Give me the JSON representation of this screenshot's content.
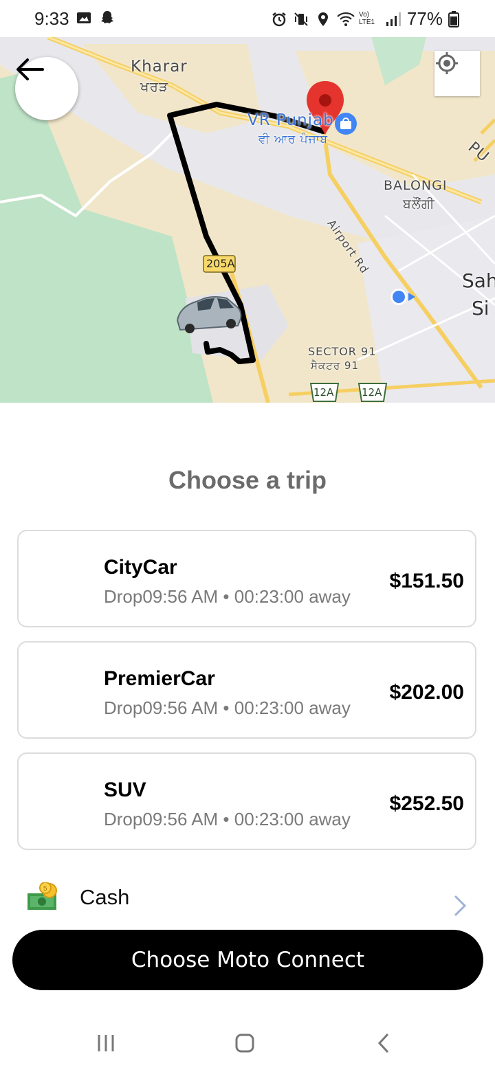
{
  "status_bar": {
    "time": "9:33",
    "battery": "77%",
    "left_icons": [
      "gallery-icon",
      "snapchat-icon"
    ],
    "right_icons": [
      "alarm-icon",
      "vibrate-icon",
      "location-icon",
      "wifi-icon",
      "volte-icon",
      "signal-icon",
      "battery-icon"
    ]
  },
  "map": {
    "labels": {
      "kharar": "Kharar",
      "kharar_local": "ਖਰੜ",
      "vr_punjab": "VR Punjab",
      "vr_punjab_local": "ਵੀ ਆਰ ਪੰਜਾਬ",
      "balongi": "BALONGI",
      "balongi_local": "ਬਲੌਂਗੀ",
      "airport_rd": "Airport Rd",
      "road_205a": "205A",
      "sector91": "SECTOR 91",
      "sector91_local": "ਸੈਕਟਰ 91",
      "road_12a_1": "12A",
      "road_12a_2": "12A",
      "sah": "Sah",
      "si": "Si",
      "pu": "PU"
    }
  },
  "panel": {
    "title": "Choose a trip"
  },
  "trips": [
    {
      "name": "CityCar",
      "subtitle": "Drop09:56 AM • 00:23:00 away",
      "price": "$151.50"
    },
    {
      "name": "PremierCar",
      "subtitle": "Drop09:56 AM • 00:23:00 away",
      "price": "$202.00"
    },
    {
      "name": "SUV",
      "subtitle": "Drop09:56 AM • 00:23:00 away",
      "price": "$252.50"
    }
  ],
  "payment": {
    "label": "Cash",
    "icon": "cash-icon"
  },
  "cta": {
    "label": "Choose Moto Connect"
  },
  "colors": {
    "map_bg": "#e6e6ea",
    "park_green": "#bfe3c7",
    "sand": "#f3e6c4",
    "road_yellow": "#f5d26a",
    "route": "#000000",
    "pin_red": "#e5342e",
    "blue_dot": "#4285f4",
    "cta_bg": "#000000"
  }
}
